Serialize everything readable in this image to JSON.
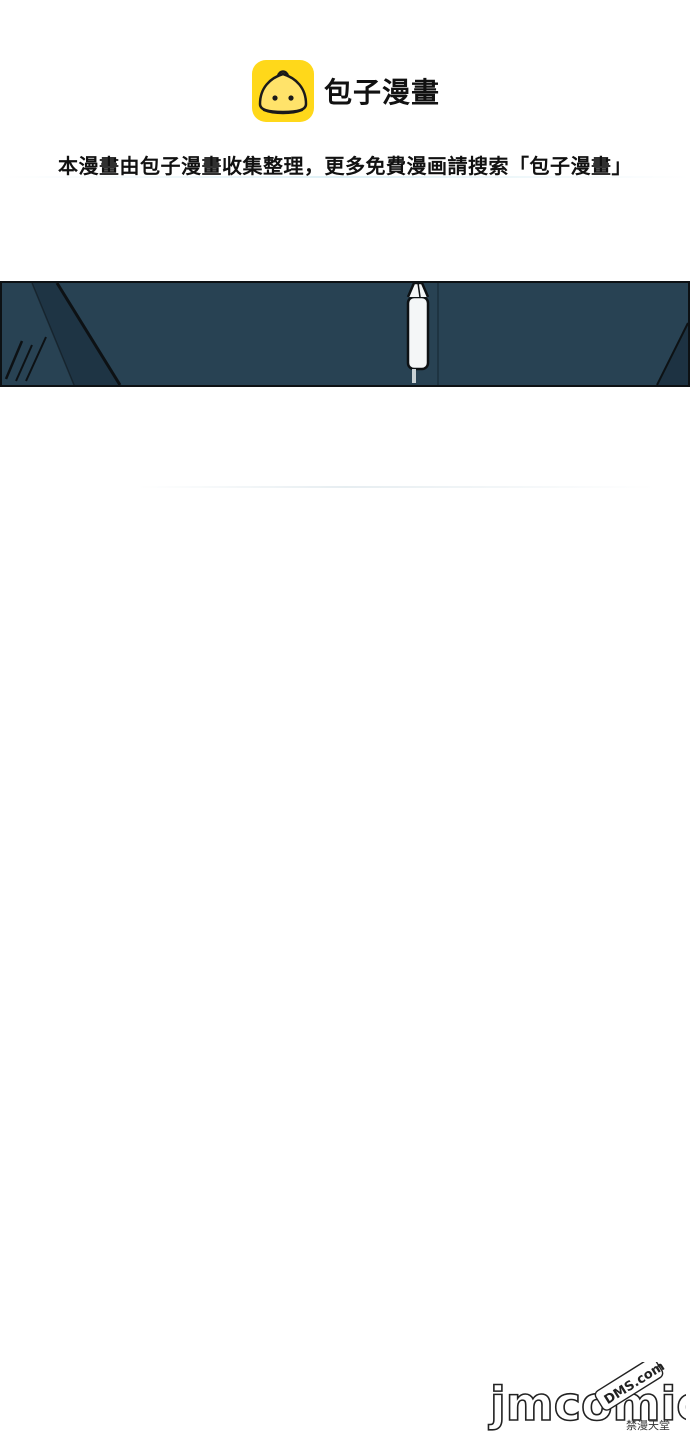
{
  "header": {
    "app_icon": "steamed-bun-icon",
    "brand_name": "包子漫畫",
    "notice": "本漫畫由包子漫畫收集整理，更多免費漫画請搜索「包子漫畫」"
  },
  "colors": {
    "icon_yellow": "#ffd81a",
    "panel_bg": "#284253",
    "panel_border": "#0d1114"
  },
  "watermark": {
    "logo_text": "jmcomic",
    "badge_text": "DMS.com",
    "sub_text": "禁漫天堂"
  }
}
